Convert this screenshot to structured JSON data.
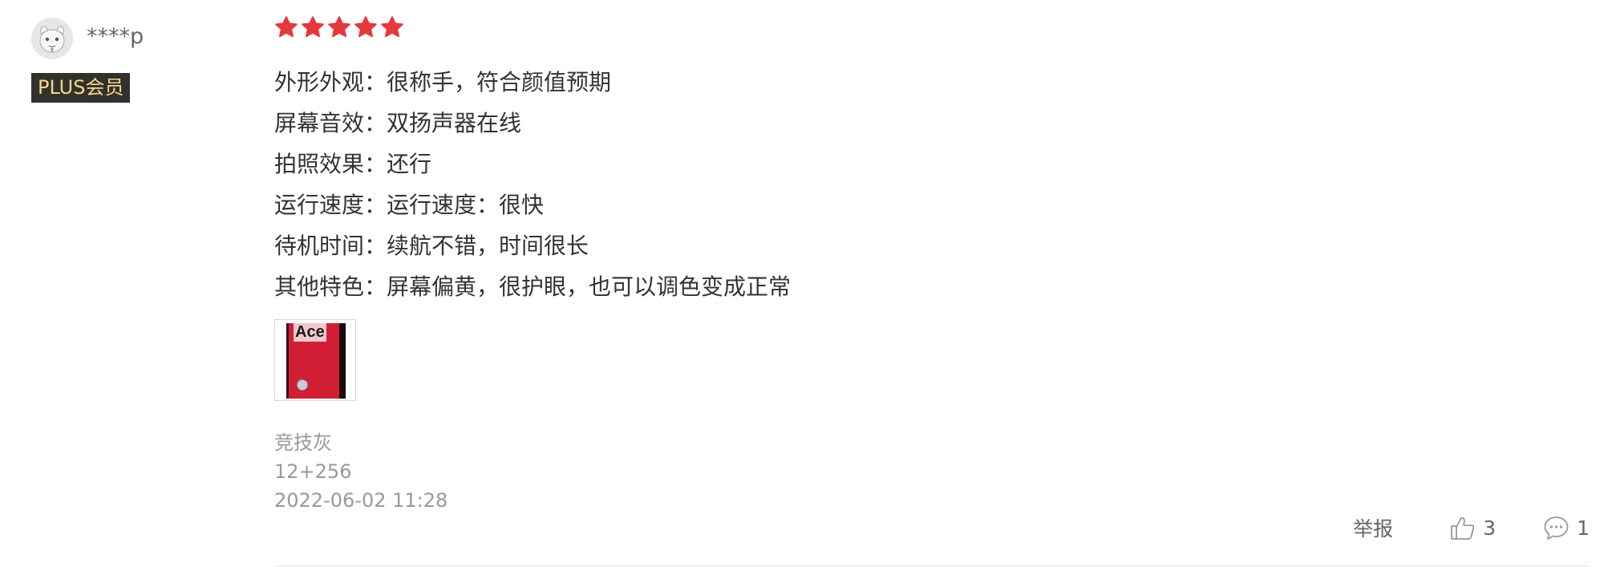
{
  "user": {
    "name": "****p",
    "badge": "PLUS会员"
  },
  "review": {
    "rating": 5,
    "rating_max": 5,
    "star_color": "#e4393c",
    "lines": [
      "外形外观：很称手，符合颜值预期",
      "屏幕音效：双扬声器在线",
      "拍照效果：还行",
      "运行速度：运行速度：很快",
      "待机时间：续航不错，时间很长",
      "其他特色：屏幕偏黄，很护眼，也可以调色变成正常"
    ],
    "photo": {
      "text": "Ace"
    },
    "color_variant": "竞技灰",
    "storage_variant": "12+256",
    "date": "2022-06-02 11:28"
  },
  "actions": {
    "report_label": "举报",
    "like_count": "3",
    "reply_count": "1"
  }
}
